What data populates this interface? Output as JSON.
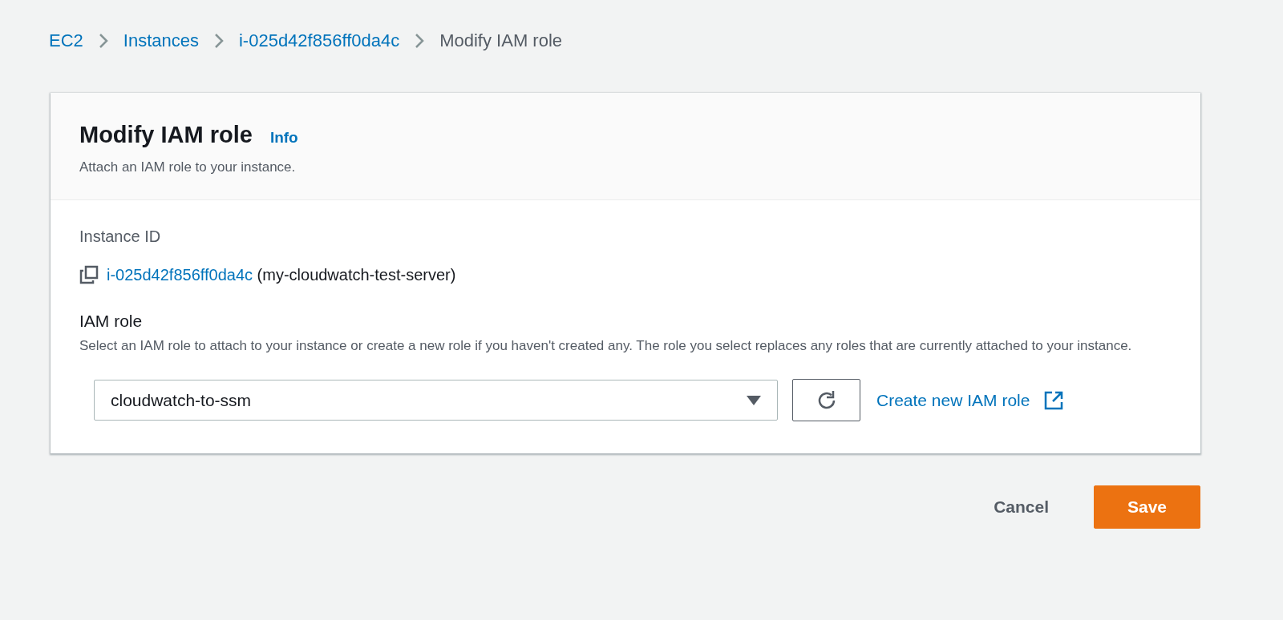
{
  "breadcrumbs": [
    {
      "label": "EC2",
      "current": false
    },
    {
      "label": "Instances",
      "current": false
    },
    {
      "label": "i-025d42f856ff0da4c",
      "current": false
    },
    {
      "label": "Modify IAM role",
      "current": true
    }
  ],
  "panel": {
    "title": "Modify IAM role",
    "info": "Info",
    "description": "Attach an IAM role to your instance.",
    "instance": {
      "label": "Instance ID",
      "id": "i-025d42f856ff0da4c",
      "name": "(my-cloudwatch-test-server)"
    },
    "role": {
      "label": "IAM role",
      "description": "Select an IAM role to attach to your instance or create a new role if you haven't created any. The role you select replaces any roles that are currently attached to your instance.",
      "value": "cloudwatch-to-ssm",
      "create_link": "Create new IAM role"
    }
  },
  "actions": {
    "cancel": "Cancel",
    "save": "Save"
  }
}
